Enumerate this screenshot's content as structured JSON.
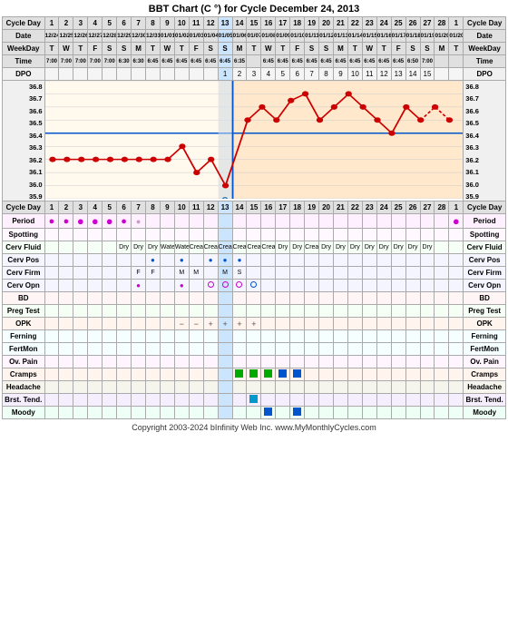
{
  "title": "BBT Chart (C °) for Cycle December 24, 2013",
  "copyright": "Copyright 2003-2024 bInfinity Web Inc.   www.MyMonthlyCycles.com",
  "header": {
    "cycle_days": [
      1,
      2,
      3,
      4,
      5,
      6,
      7,
      8,
      9,
      10,
      11,
      12,
      13,
      14,
      15,
      16,
      17,
      18,
      19,
      20,
      21,
      22,
      23,
      24,
      25,
      26,
      27,
      28,
      1
    ],
    "dates": [
      "12/24",
      "12/25",
      "12/26",
      "12/27",
      "12/28",
      "12/29",
      "12/30",
      "12/31",
      "01/02",
      "01/03",
      "01/04",
      "01/05",
      "01/06",
      "01/07",
      "01/08",
      "01/09",
      "01/10",
      "01/11",
      "01/12",
      "01/13",
      "01/14",
      "01/15",
      "01/16",
      "01/17",
      "01/18",
      "01/19",
      "01/20",
      "01/21",
      "01/20"
    ],
    "weekdays": [
      "T",
      "W",
      "T",
      "F",
      "S",
      "S",
      "M",
      "T",
      "W",
      "T",
      "F",
      "S",
      "S",
      "M",
      "T",
      "W",
      "T",
      "F",
      "S",
      "S",
      "M",
      "T",
      "W",
      "T",
      "F",
      "S",
      "S",
      "M",
      "T"
    ],
    "times": [
      "7:00",
      "7:00",
      "7:00",
      "7:00",
      "7:00",
      "6:30",
      "6:30",
      "6:45",
      "6:45",
      "6:45",
      "6:45",
      "6:45",
      "6:45",
      "6:35",
      "",
      "6:45",
      "6:45",
      "6:45",
      "6:45",
      "6:45",
      "6:45",
      "6:45",
      "6:45",
      "6:45",
      "6:45",
      "6:50",
      "7:00",
      "",
      ""
    ],
    "dpo": [
      "",
      "",
      "",
      "",
      "",
      "",
      "",
      "",
      "",
      "",
      "",
      "",
      "1",
      "2",
      "3",
      "4",
      "5",
      "6",
      "7",
      "8",
      "9",
      "10",
      "11",
      "12",
      "13",
      "14",
      "15",
      "",
      ""
    ]
  },
  "temps": {
    "label_left": "DPO",
    "rows": [
      {
        "val": "36.8",
        "right": "36.8"
      },
      {
        "val": "36.7",
        "right": "36.7"
      },
      {
        "val": "36.6",
        "right": "36.6"
      },
      {
        "val": "36.5",
        "right": "36.5"
      },
      {
        "val": "36.4",
        "right": "36.4"
      },
      {
        "val": "36.3",
        "right": "36.3"
      },
      {
        "val": "36.2",
        "right": "36.2"
      },
      {
        "val": "36.1",
        "right": "36.1"
      },
      {
        "val": "36.0",
        "right": "36.0"
      },
      {
        "val": "35.9",
        "right": "35.9"
      }
    ]
  },
  "rows": {
    "period_label": "Period",
    "spotting_label": "Spotting",
    "cerv_fluid_label": "Cerv Fluid",
    "cerv_pos_label": "Cerv Pos",
    "cerv_firm_label": "Cerv Firm",
    "cerv_opn_label": "Cerv Opn",
    "bd_label": "BD",
    "preg_label": "Preg Test",
    "opk_label": "OPK",
    "ferning_label": "Ferning",
    "fertmon_label": "FertMon",
    "ovpain_label": "Ov. Pain",
    "cramps_label": "Cramps",
    "headache_label": "Headache",
    "brst_label": "Brst. Tend.",
    "moody_label": "Moody"
  }
}
